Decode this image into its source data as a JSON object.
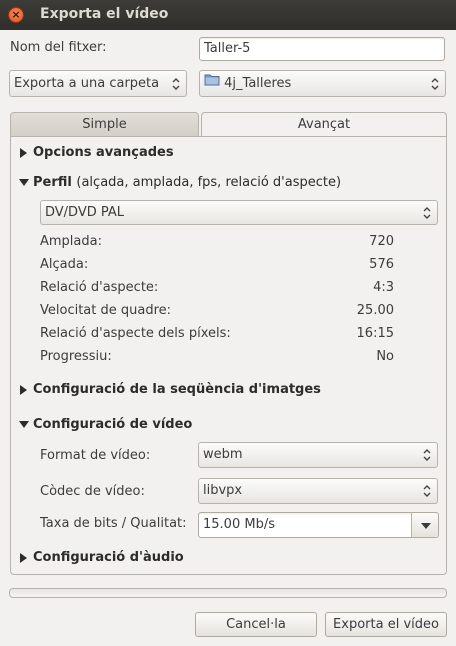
{
  "window": {
    "title": "Exporta el vídeo"
  },
  "filename": {
    "label": "Nom del fitxer:",
    "value": "Taller-5"
  },
  "destination": {
    "mode": "Exporta a una carpeta",
    "folder": "4j_Talleres",
    "folder_icon": "folder-icon"
  },
  "tabs": [
    {
      "label": "Simple",
      "active": false
    },
    {
      "label": "Avançat",
      "active": true
    }
  ],
  "sections": {
    "advanced_options": {
      "title": "Opcions avançades",
      "expanded": false
    },
    "profile": {
      "title": "Perfil",
      "subtitle": "(alçada, amplada, fps, relació d'aspecte)",
      "expanded": true,
      "selected": "DV/DVD PAL",
      "properties": [
        {
          "label": "Amplada:",
          "value": "720"
        },
        {
          "label": "Alçada:",
          "value": "576"
        },
        {
          "label": "Relació d'aspecte:",
          "value": "4:3"
        },
        {
          "label": "Velocitat de quadre:",
          "value": "25.00"
        },
        {
          "label": "Relació d'aspecte dels píxels:",
          "value": "16:15"
        },
        {
          "label": "Progressiu:",
          "value": "No"
        }
      ]
    },
    "image_sequence": {
      "title": "Configuració de la seqüència d'imatges",
      "expanded": false
    },
    "video": {
      "title": "Configuració de vídeo",
      "expanded": true,
      "format_label": "Format de vídeo:",
      "format_value": "webm",
      "codec_label": "Còdec de vídeo:",
      "codec_value": "libvpx",
      "bitrate_label": "Taxa de bits / Qualitat:",
      "bitrate_value": "15.00 Mb/s"
    },
    "audio": {
      "title": "Configuració d'àudio",
      "expanded": false
    }
  },
  "progress": {
    "fraction": 0.0
  },
  "buttons": {
    "cancel": "Cancel·la",
    "export": "Exporta el vídeo"
  },
  "colors": {
    "accent": "#f07746",
    "titlebar": "#3d3c38",
    "close": "#e2531f"
  }
}
